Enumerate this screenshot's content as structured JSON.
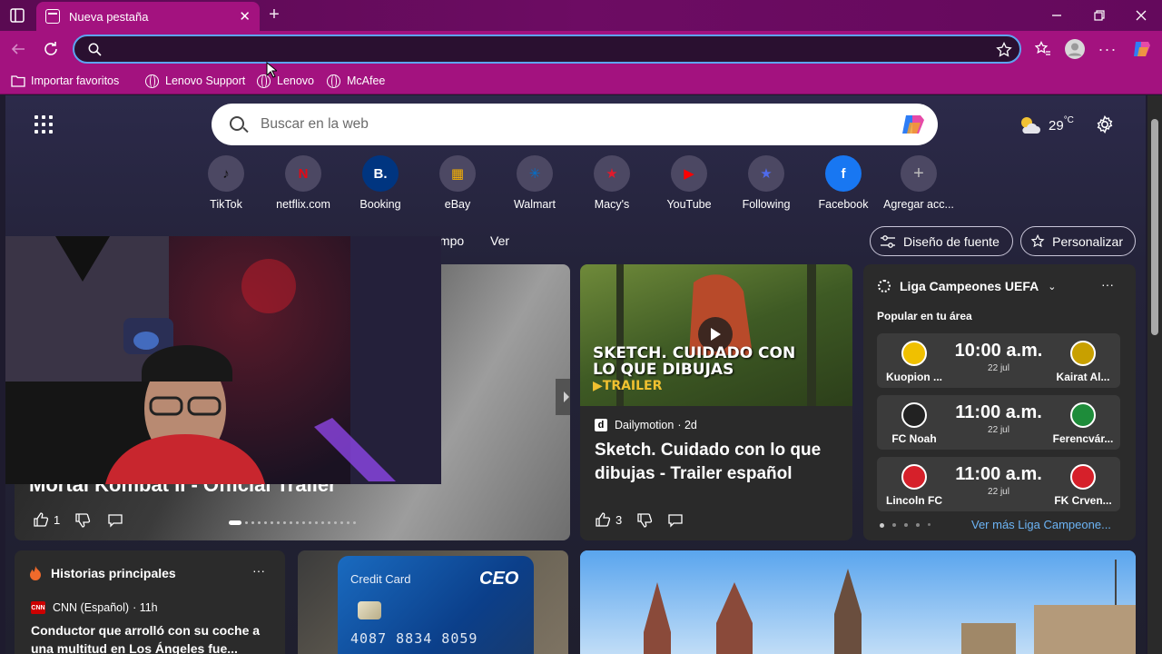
{
  "browser": {
    "tab_title": "Nueva pestaña",
    "address_value": "",
    "favorites": [
      {
        "label": "Importar favoritos"
      },
      {
        "label": "Lenovo Support"
      },
      {
        "label": "Lenovo"
      },
      {
        "label": "McAfee"
      }
    ]
  },
  "newtab": {
    "search_placeholder": "Buscar en la web",
    "weather": {
      "temp": "29",
      "unit": "°C"
    },
    "quick_links": [
      {
        "label": "TikTok",
        "glyph": "♪",
        "color": "#111111"
      },
      {
        "label": "netflix.com",
        "glyph": "N",
        "color": "#e50914"
      },
      {
        "label": "Booking",
        "glyph": "B.",
        "color": "#003580"
      },
      {
        "label": "eBay",
        "glyph": "▦",
        "color": "#f5af02"
      },
      {
        "label": "Walmart",
        "glyph": "✳",
        "color": "#0071ce"
      },
      {
        "label": "Macy's",
        "glyph": "★",
        "color": "#e21a2c"
      },
      {
        "label": "YouTube",
        "glyph": "▶",
        "color": "#ff0000"
      },
      {
        "label": "Following",
        "glyph": "★",
        "color": "#4f6bed"
      },
      {
        "label": "Facebook",
        "glyph": "f",
        "color": "#1877f2"
      },
      {
        "label": "Agregar acc...",
        "glyph": "+",
        "color": "#5a566e"
      }
    ],
    "nav": {
      "tiempo": "Tiempo",
      "ver": "Ver",
      "feed_layout": "Diseño de fuente",
      "personalize": "Personalizar"
    },
    "hero": {
      "title": "Mortal Kombat II - Official Trailer",
      "likes": "1"
    },
    "video_card": {
      "thumb_line1": "SKETCH. CUIDADO CON",
      "thumb_line2": "LO QUE DIBUJAS",
      "thumb_tag": "▶TRAILER",
      "source": "Dailymotion",
      "age": "· 2d",
      "title": "Sketch. Cuidado con lo que dibujas - Trailer español",
      "likes": "3"
    },
    "sports": {
      "league": "Liga Campeones UEFA",
      "subtitle": "Popular en tu área",
      "more": "Ver más Liga Campeone...",
      "matches": [
        {
          "home": "Kuopion ...",
          "time": "10:00 a.m.",
          "date": "22 jul",
          "away": "Kairat Al...",
          "home_color": "#f0c000",
          "away_color": "#c8a000"
        },
        {
          "home": "FC Noah",
          "time": "11:00 a.m.",
          "date": "22 jul",
          "away": "Ferencvár...",
          "home_color": "#222222",
          "away_color": "#1e8c3a"
        },
        {
          "home": "Lincoln FC",
          "time": "11:00 a.m.",
          "date": "22 jul",
          "away": "FK Crven...",
          "home_color": "#d6202a",
          "away_color": "#d6202a"
        }
      ]
    },
    "stories": {
      "title": "Historias principales",
      "source": "CNN (Español)",
      "age": "· 11h",
      "headline": "Conductor que arrolló con su coche a una multitud en Los Ángeles fue..."
    },
    "credit_card": {
      "label": "Credit Card",
      "brand": "CEO",
      "number": "4087 8834 8059"
    }
  }
}
